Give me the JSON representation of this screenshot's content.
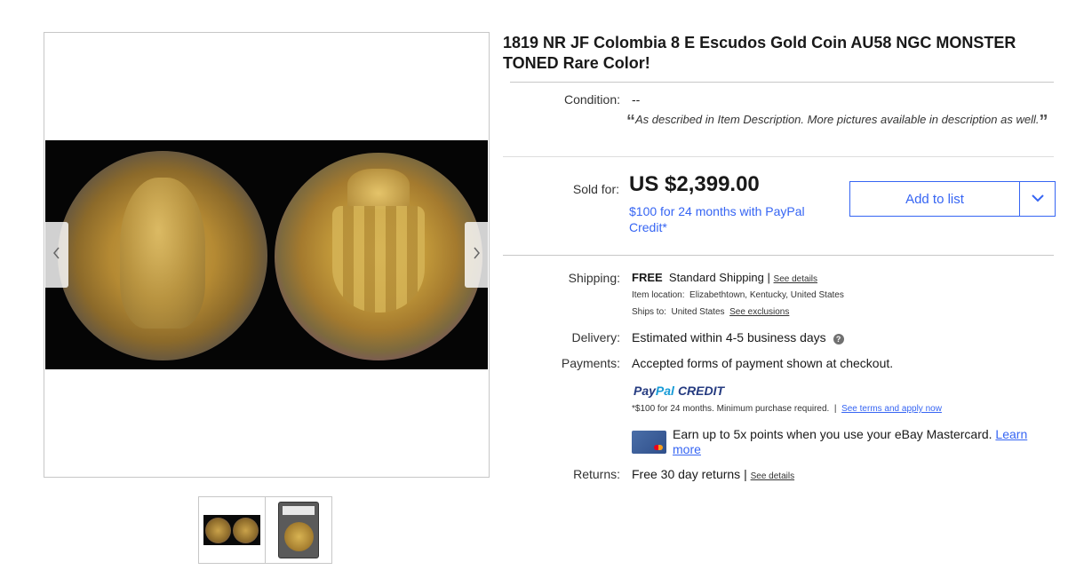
{
  "listing": {
    "title": "1819 NR JF Colombia 8 E Escudos Gold Coin AU58 NGC MONSTER TONED Rare Color!"
  },
  "gallery": {
    "prev_icon": "chevron-left-icon",
    "next_icon": "chevron-right-icon",
    "thumbnails": [
      {
        "name": "coin-obverse-reverse-thumbnail"
      },
      {
        "name": "ngc-slab-thumbnail"
      }
    ]
  },
  "condition": {
    "label": "Condition:",
    "value": "--",
    "open_quote": "“",
    "description": "As described in Item Description. More pictures available in description as well.",
    "close_quote": "”"
  },
  "price": {
    "label": "Sold for:",
    "value": "US $2,399.00",
    "paypal_offer": "$100 for 24 months with PayPal Credit*"
  },
  "actions": {
    "add_to_list": "Add to list",
    "dropdown_icon": "chevron-down-icon"
  },
  "shipping": {
    "label": "Shipping:",
    "free": "FREE",
    "method": "Standard Shipping",
    "separator": "|",
    "see_details": "See details",
    "location_label": "Item location:",
    "location": "Elizabethtown, Kentucky, United States",
    "ships_to_label": "Ships to:",
    "ships_to": "United States",
    "see_exclusions": "See exclusions"
  },
  "delivery": {
    "label": "Delivery:",
    "value": "Estimated within 4-5 business days",
    "help_icon": "help-icon",
    "help_glyph": "?"
  },
  "payments": {
    "label": "Payments:",
    "value": "Accepted forms of payment shown at checkout.",
    "paypal_pay": "Pay",
    "paypal_pal": "Pal",
    "paypal_credit": "CREDIT",
    "terms_text": "*$100 for 24 months. Minimum purchase required.",
    "separator": "|",
    "terms_link": "See terms and apply now",
    "mastercard_text": "Earn up to 5x points when you use your eBay Mastercard.",
    "learn_more": "Learn more"
  },
  "returns": {
    "label": "Returns:",
    "value": "Free 30 day returns",
    "separator": "|",
    "see_details": "See details"
  },
  "colors": {
    "accent": "#3665f3",
    "paypal_dark": "#253b80",
    "paypal_light": "#179bd7",
    "border": "#c7c7c7"
  }
}
